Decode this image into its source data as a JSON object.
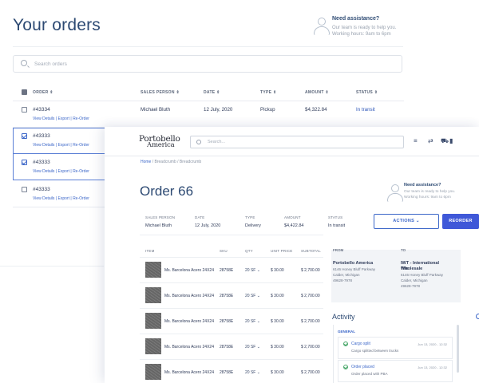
{
  "back": {
    "title": "Your orders",
    "assist_title": "Need assistance?",
    "assist_line1": "Our team is ready to help you.",
    "assist_line2": "Working hours: 9am to 6pm",
    "search_placeholder": "Search orders",
    "columns": [
      "ORDER ⇕",
      "SALES PERSON ⇕",
      "DATE ⇕",
      "TYPE ⇕",
      "AMOUNT ⇕",
      "STATUS ⇕"
    ],
    "link_details": "View Details",
    "link_export": "Export",
    "link_reorder": "Re-Order",
    "link_sep": "|",
    "rows": [
      {
        "order": "#43334",
        "sales": "Michael Bluth",
        "date": "12 July, 2020",
        "type": "Pickup",
        "amount": "$4,322.84",
        "status": "In transit",
        "checked": false
      },
      {
        "order": "#43333",
        "checked": true
      },
      {
        "order": "#43333",
        "checked": true
      },
      {
        "order": "#43333",
        "checked": false
      }
    ]
  },
  "front": {
    "logo_line1": "Portobello",
    "logo_line2": "America",
    "search_placeholder": "Search...",
    "nav_icons": [
      "menu-icon",
      "swap-icon",
      "truck-icon",
      "bar-chart-icon"
    ],
    "nav_glyphs": {
      "menu": "≡",
      "swap": "⇄",
      "truck": "⛟",
      "chart": "▮"
    },
    "breadcrumb": [
      "Home",
      "Breadcrumb",
      "Breadcrumb"
    ],
    "breadcrumb_sep": "/",
    "order_title": "Order 66",
    "assist_title": "Need assistance?",
    "assist_line1": "Our team is ready to help you.",
    "assist_line2": "Working hours: 9am to 6pm",
    "summary_heads": [
      "SALES PERSON",
      "DATE",
      "TYPE",
      "AMOUNT",
      "STATUS"
    ],
    "summary_vals": [
      "Michael Bluth",
      "12 July, 2020",
      "Delivery",
      "$4,422.84",
      "In transit"
    ],
    "actions_label": "ACTIONS ⌄",
    "reorder_label": "REORDER",
    "item_heads": [
      "ITEM",
      "SKU",
      "QTY",
      "UNIT PRICE",
      "SUBTOTAL"
    ],
    "items": [
      {
        "name": "Ms. Barcelona Acero 24X24",
        "sku": "28758E",
        "qty": "20 SF ⌄",
        "price": "$ 30.00",
        "subtotal": "$ 2,700.00"
      },
      {
        "name": "Ms. Barcelona Acero 24X24",
        "sku": "28758E",
        "qty": "20 SF ⌄",
        "price": "$ 30.00",
        "subtotal": "$ 2,700.00"
      },
      {
        "name": "Ms. Barcelona Acero 24X24",
        "sku": "28758E",
        "qty": "20 SF ⌄",
        "price": "$ 30.00",
        "subtotal": "$ 2,700.00"
      },
      {
        "name": "Ms. Barcelona Acero 24X24",
        "sku": "28758E",
        "qty": "20 SF ⌄",
        "price": "$ 30.00",
        "subtotal": "$ 2,700.00"
      },
      {
        "name": "Ms. Barcelona Acero 24X24",
        "sku": "28758E",
        "qty": "20 SF ⌄",
        "price": "$ 30.00",
        "subtotal": "$ 2,700.00"
      }
    ],
    "from_label": "FROM",
    "from_name": "Portobello America",
    "from_addr1": "6146 Honey Bluff Parkway",
    "from_addr2": "Calder, Michigan",
    "from_addr3": "49628-7978",
    "to_label": "TO",
    "to_name1": "IWT - International Wholesale",
    "to_name2": "Tile",
    "to_addr1": "6146 Honey Bluff Parkway",
    "to_addr2": "Calder, Michigan",
    "to_addr3": "49628-7978",
    "activity_title": "Activity",
    "activity_group": "GENERAL",
    "events": [
      {
        "title": "Cargo split",
        "desc": "Cargo splitted between trucks",
        "time": "Jun 13, 2020 - 12:32"
      },
      {
        "title": "Order placed",
        "desc": "Order placed with PBA",
        "time": "Jun 13, 2020 - 12:32"
      }
    ]
  },
  "colors": {
    "primary": "#3f58d8",
    "link": "#3b66c8",
    "heading": "#2d4a73",
    "success": "#4aa86b"
  }
}
